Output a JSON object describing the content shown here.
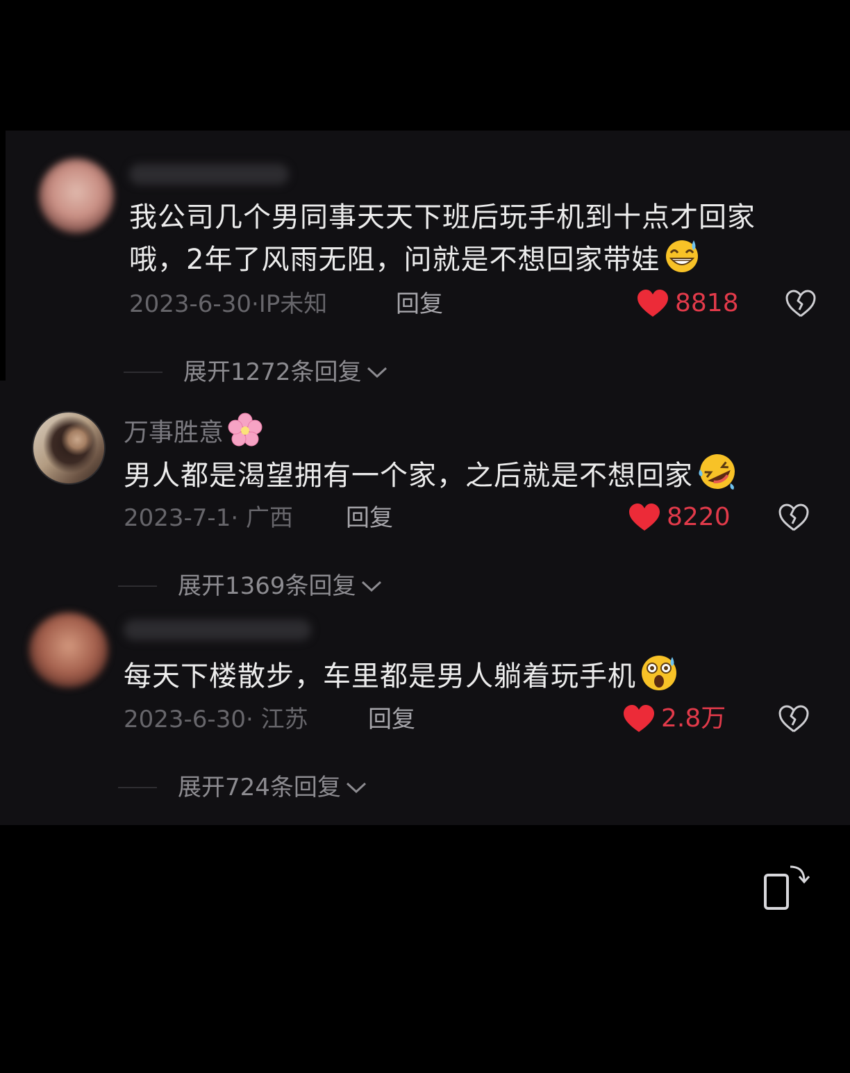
{
  "comments": [
    {
      "lines": [
        "我公司几个男同事天天下班后玩手机到十点才回家",
        "哦，2年了风雨无阻，问就是不想回家带娃"
      ],
      "emoji": "grinning-sweat-emoji",
      "meta": "2023-6-30·IP未知",
      "reply_label": "回复",
      "likes": "8818",
      "expand_label": "展开1272条回复"
    },
    {
      "username": "万事胜意",
      "lines": [
        "男人都是渴望拥有一个家，之后就是不想回家"
      ],
      "emoji": "rolling-laughing-emoji",
      "meta": "2023-7-1· 广西",
      "reply_label": "回复",
      "likes": "8220",
      "expand_label": "展开1369条回复"
    },
    {
      "lines": [
        "每天下楼散步，车里都是男人躺着玩手机"
      ],
      "emoji": "astonished-emoji",
      "meta": "2023-6-30· 江苏",
      "reply_label": "回复",
      "likes": "2.8万",
      "expand_label": "展开724条回复"
    }
  ],
  "colors": {
    "background": "#000000",
    "panel": "#111013",
    "like_red": "#e23a4a",
    "text": "#ececec",
    "meta": "#67666b"
  }
}
